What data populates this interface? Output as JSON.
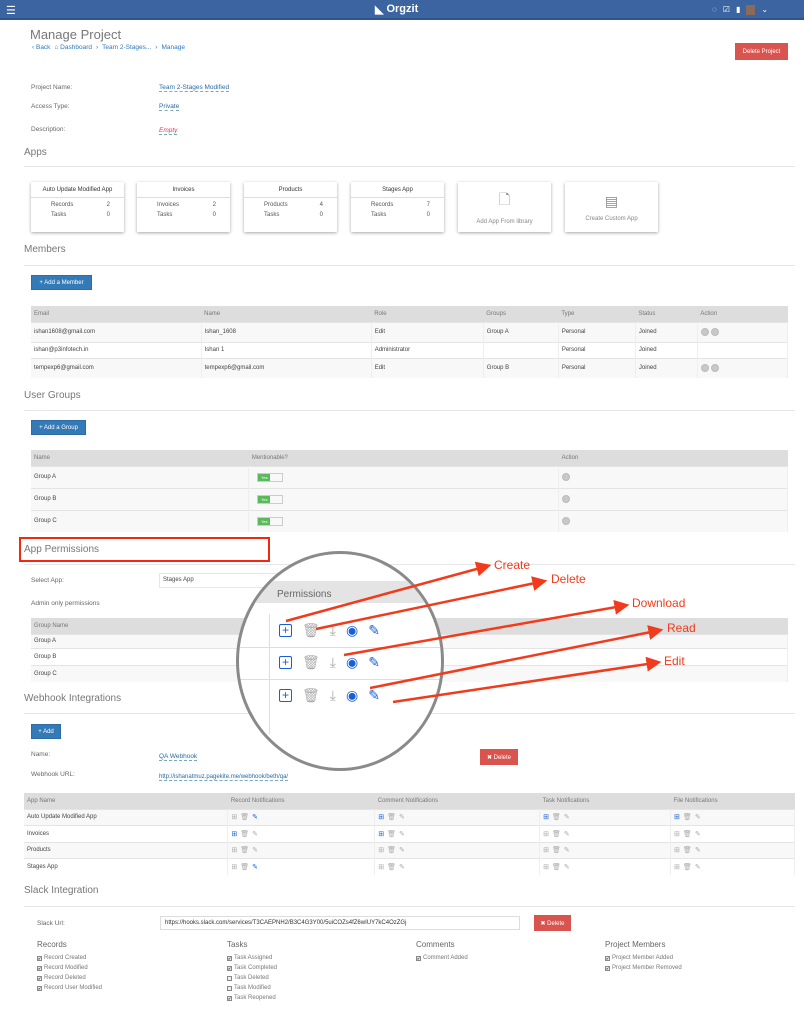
{
  "header": {
    "brand": "Orgzit",
    "icons": [
      "menu-icon",
      "chat-icon",
      "checkbox-icon",
      "file-icon",
      "avatar"
    ]
  },
  "page": {
    "title": "Manage Project",
    "breadcrumb": [
      "Back",
      "Dashboard",
      "Team 2-Stages...",
      "Manage"
    ],
    "delete_project": "Delete Project"
  },
  "project": {
    "name_label": "Project Name:",
    "name": "Team 2-Stages Modified",
    "access_label": "Access Type:",
    "access": "Private",
    "desc_label": "Description:",
    "desc": "Empty"
  },
  "apps": {
    "heading": "Apps",
    "cards": [
      {
        "title": "Auto Update Modified App",
        "rows": [
          [
            "Records",
            "2"
          ],
          [
            "Tasks",
            "0"
          ]
        ]
      },
      {
        "title": "Invoices",
        "rows": [
          [
            "Invoices",
            "2"
          ],
          [
            "Tasks",
            "0"
          ]
        ]
      },
      {
        "title": "Products",
        "rows": [
          [
            "Products",
            "4"
          ],
          [
            "Tasks",
            "0"
          ]
        ]
      },
      {
        "title": "Stages App",
        "rows": [
          [
            "Records",
            "7"
          ],
          [
            "Tasks",
            "0"
          ]
        ]
      }
    ],
    "add_library": "Add App From library",
    "create_custom": "Create Custom App"
  },
  "members": {
    "heading": "Members",
    "add": "+ Add a Member",
    "columns": [
      "Email",
      "Name",
      "Role",
      "Groups",
      "Type",
      "Status",
      "Action"
    ],
    "rows": [
      [
        "ishan1608@gmail.com",
        "Ishan_1608",
        "Edit",
        "Group A",
        "Personal",
        "Joined"
      ],
      [
        "ishan@p3infotech.in",
        "Ishan 1",
        "Administrator",
        "",
        "Personal",
        "Joined"
      ],
      [
        "tempexp6@gmail.com",
        "tempexp6@gmail.com",
        "Edit",
        "Group B",
        "Personal",
        "Joined"
      ]
    ]
  },
  "groups": {
    "heading": "User Groups",
    "add": "+ Add a Group",
    "columns": [
      "Name",
      "Mentionable?",
      "Action"
    ],
    "rows": [
      "Group A",
      "Group B",
      "Group C"
    ],
    "toggle": "Yes"
  },
  "permissions": {
    "heading": "App Permissions",
    "select_label": "Select App:",
    "select_value": "Stages App",
    "admin_only": "Admin only permissions",
    "col": "Group Name",
    "rows": [
      "Group A",
      "Group B",
      "Group C"
    ],
    "magnified_heading": "Permissions",
    "annotations": [
      "Create",
      "Delete",
      "Download",
      "Read",
      "Edit"
    ],
    "annotation_color": "#f23b1c"
  },
  "webhook": {
    "heading": "Webhook Integrations",
    "add": "+ Add",
    "name_label": "Name:",
    "name": "QA Webhook",
    "delete": "✖ Delete",
    "url_label": "Webhook URL:",
    "url": "http://ishanatmuz.pagekite.me/webhook/beth/qa/",
    "columns": [
      "App Name",
      "Record Notifications",
      "Comment Notifications",
      "Task Notifications",
      "File Notifications"
    ],
    "rows": [
      {
        "app": "Auto Update Modified App",
        "on": [
          [
            0,
            0,
            1
          ],
          [
            1,
            0,
            0
          ],
          [
            1,
            0,
            0
          ],
          [
            1,
            0,
            0
          ]
        ]
      },
      {
        "app": "Invoices",
        "on": [
          [
            1,
            0,
            0
          ],
          [
            1,
            0,
            0
          ],
          [
            0,
            0,
            0
          ],
          [
            0,
            0,
            0
          ]
        ]
      },
      {
        "app": "Products",
        "on": [
          [
            0,
            0,
            0
          ],
          [
            0,
            0,
            0
          ],
          [
            0,
            0,
            0
          ],
          [
            0,
            0,
            0
          ]
        ]
      },
      {
        "app": "Stages App",
        "on": [
          [
            0,
            0,
            1
          ],
          [
            0,
            0,
            0
          ],
          [
            0,
            0,
            0
          ],
          [
            0,
            0,
            0
          ]
        ]
      }
    ]
  },
  "slack": {
    "heading": "Slack Integration",
    "url_label": "Slack Url:",
    "url": "https://hooks.slack.com/services/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",
    "delete": "✖ Delete",
    "groups": [
      {
        "title": "Records",
        "items": [
          [
            "Record Created",
            true
          ],
          [
            "Record Modified",
            true
          ],
          [
            "Record Deleted",
            true
          ],
          [
            "Record User Modified",
            true
          ]
        ]
      },
      {
        "title": "Tasks",
        "items": [
          [
            "Task Assigned",
            true
          ],
          [
            "Task Completed",
            true
          ],
          [
            "Task Deleted",
            false
          ],
          [
            "Task Modified",
            false
          ],
          [
            "Task Reopened",
            true
          ]
        ]
      },
      {
        "title": "Comments",
        "items": [
          [
            "Comment Added",
            true
          ]
        ]
      },
      {
        "title": "Project Members",
        "items": [
          [
            "Project Member Added",
            true
          ],
          [
            "Project Member Removed",
            true
          ]
        ]
      }
    ]
  }
}
